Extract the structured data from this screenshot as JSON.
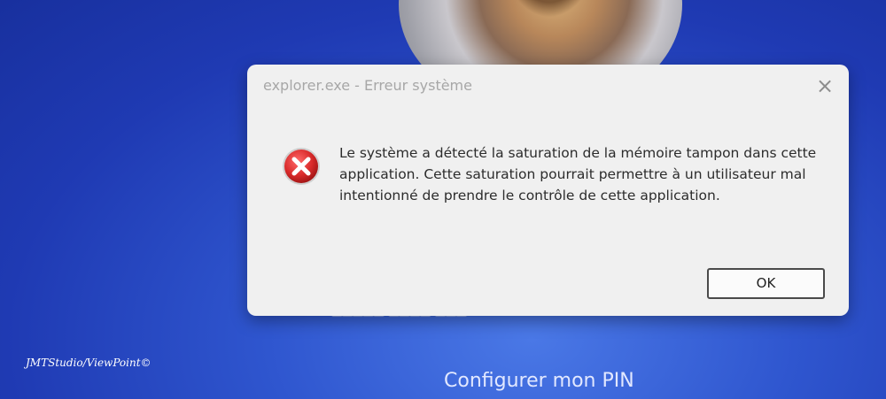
{
  "dialog": {
    "title": "explorer.exe - Erreur système",
    "message": "Le système a détecté la saturation de la mémoire tampon dans cette application. Cette saturation pourrait permettre à un utilisateur mal intentionné de prendre le contrôle de cette application.",
    "ok_label": "OK",
    "close_icon": "×",
    "icon": "error-icon"
  },
  "lockscreen": {
    "configure_pin_label": "Configurer mon PIN"
  },
  "watermark": "JMTStudio/ViewPoint©",
  "colors": {
    "background": "#1f3ab3",
    "dialog": "#f0f0f0",
    "error_red": "#d32f2f"
  }
}
